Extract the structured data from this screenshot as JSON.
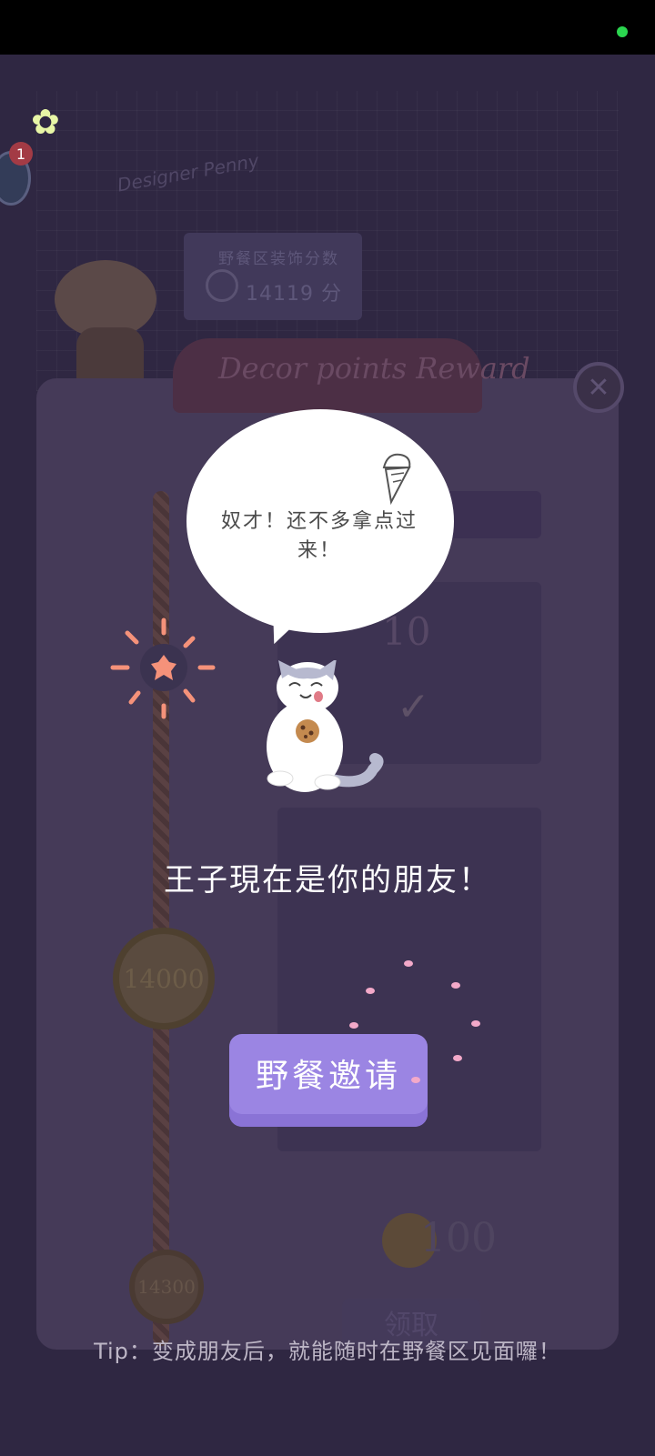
{
  "status_bar": {
    "indicator_color": "#2bd64f"
  },
  "background_board": {
    "designer_note": "Designer Penny",
    "score_label": "野餐区装饰分数",
    "score_value": "14119 分",
    "ribbon_title": "Decor points Reward",
    "reward_amount_1": "10",
    "milestone_1": "14000",
    "milestone_2": "14300",
    "reward_amount_2": "100",
    "claim_label": "领取"
  },
  "top_left": {
    "clover_icon": "four-leaf-clover",
    "notification_count": "1"
  },
  "dialog": {
    "speech_bubble": "奴才！还不多拿点过来！",
    "friend_message": "王子現在是你的朋友！",
    "invite_button": "野餐邀请",
    "tip": "Tip：变成朋友后，就能随时在野餐区见面囉！"
  },
  "colors": {
    "overlay_bg": "#2f2742",
    "button_purple": "#9b85e3",
    "sun_orange": "#f5927a"
  }
}
